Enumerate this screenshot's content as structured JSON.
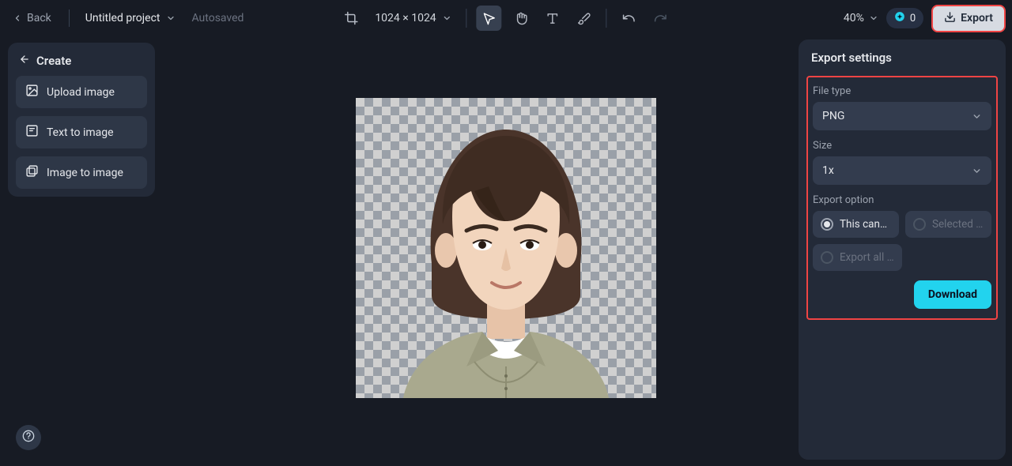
{
  "topbar": {
    "back": "Back",
    "project_name": "Untitled project",
    "autosaved": "Autosaved",
    "canvas_size": "1024 × 1024",
    "zoom": "40%",
    "credits": "0",
    "export_label": "Export"
  },
  "create": {
    "title": "Create",
    "items": [
      {
        "label": "Upload image"
      },
      {
        "label": "Text to image"
      },
      {
        "label": "Image to image"
      }
    ]
  },
  "export": {
    "title": "Export settings",
    "file_type_label": "File type",
    "file_type_value": "PNG",
    "size_label": "Size",
    "size_value": "1x",
    "option_label": "Export option",
    "options": {
      "this_canvas": "This canvas",
      "selected": "Selected l…",
      "export_all": "Export all …"
    },
    "download": "Download"
  },
  "colors": {
    "highlight_border": "#ef4444",
    "accent": "#22d3ee"
  }
}
